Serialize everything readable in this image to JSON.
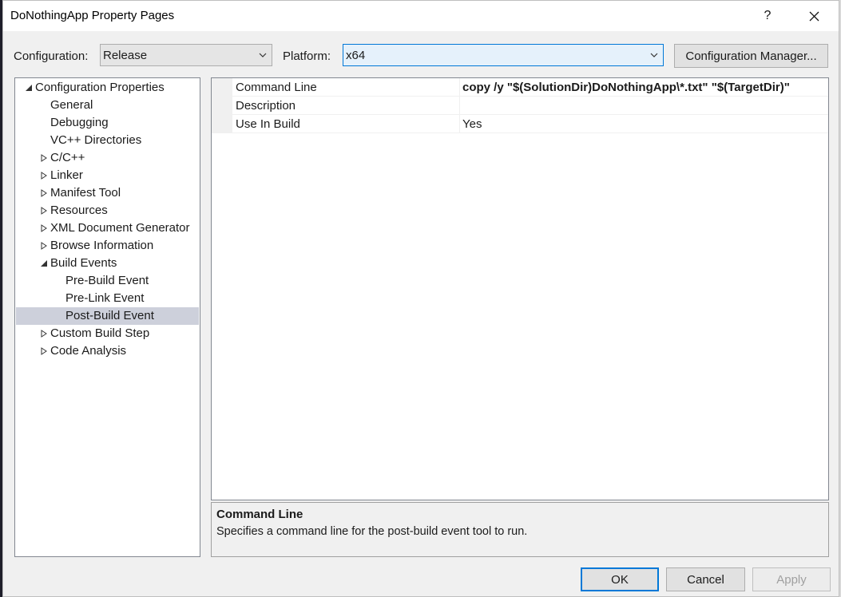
{
  "window": {
    "title": "DoNothingApp Property Pages",
    "help_label": "?"
  },
  "toolbar": {
    "configuration_label": "Configuration:",
    "configuration_value": "Release",
    "platform_label": "Platform:",
    "platform_value": "x64",
    "config_manager_label": "Configuration Manager..."
  },
  "tree": {
    "items": [
      {
        "label": "Configuration Properties",
        "level": 0,
        "expander": "expanded"
      },
      {
        "label": "General",
        "level": 1,
        "expander": "none"
      },
      {
        "label": "Debugging",
        "level": 1,
        "expander": "none"
      },
      {
        "label": "VC++ Directories",
        "level": 1,
        "expander": "none"
      },
      {
        "label": "C/C++",
        "level": 1,
        "expander": "collapsed"
      },
      {
        "label": "Linker",
        "level": 1,
        "expander": "collapsed"
      },
      {
        "label": "Manifest Tool",
        "level": 1,
        "expander": "collapsed"
      },
      {
        "label": "Resources",
        "level": 1,
        "expander": "collapsed"
      },
      {
        "label": "XML Document Generator",
        "level": 1,
        "expander": "collapsed"
      },
      {
        "label": "Browse Information",
        "level": 1,
        "expander": "collapsed"
      },
      {
        "label": "Build Events",
        "level": 1,
        "expander": "expanded"
      },
      {
        "label": "Pre-Build Event",
        "level": 2,
        "expander": "none"
      },
      {
        "label": "Pre-Link Event",
        "level": 2,
        "expander": "none"
      },
      {
        "label": "Post-Build Event",
        "level": 2,
        "expander": "none",
        "selected": true
      },
      {
        "label": "Custom Build Step",
        "level": 1,
        "expander": "collapsed"
      },
      {
        "label": "Code Analysis",
        "level": 1,
        "expander": "collapsed"
      }
    ]
  },
  "grid": {
    "rows": [
      {
        "name": "Command Line",
        "value": "copy /y \"$(SolutionDir)DoNothingApp\\*.txt\" \"$(TargetDir)\"",
        "bold": true
      },
      {
        "name": "Description",
        "value": "",
        "bold": false
      },
      {
        "name": "Use In Build",
        "value": "Yes",
        "bold": false
      }
    ]
  },
  "description": {
    "title": "Command Line",
    "text": "Specifies a command line for the post-build event tool to run."
  },
  "buttons": {
    "ok": "OK",
    "cancel": "Cancel",
    "apply": "Apply"
  },
  "colors": {
    "accent": "#0078d7",
    "selection": "#cdd0db"
  }
}
